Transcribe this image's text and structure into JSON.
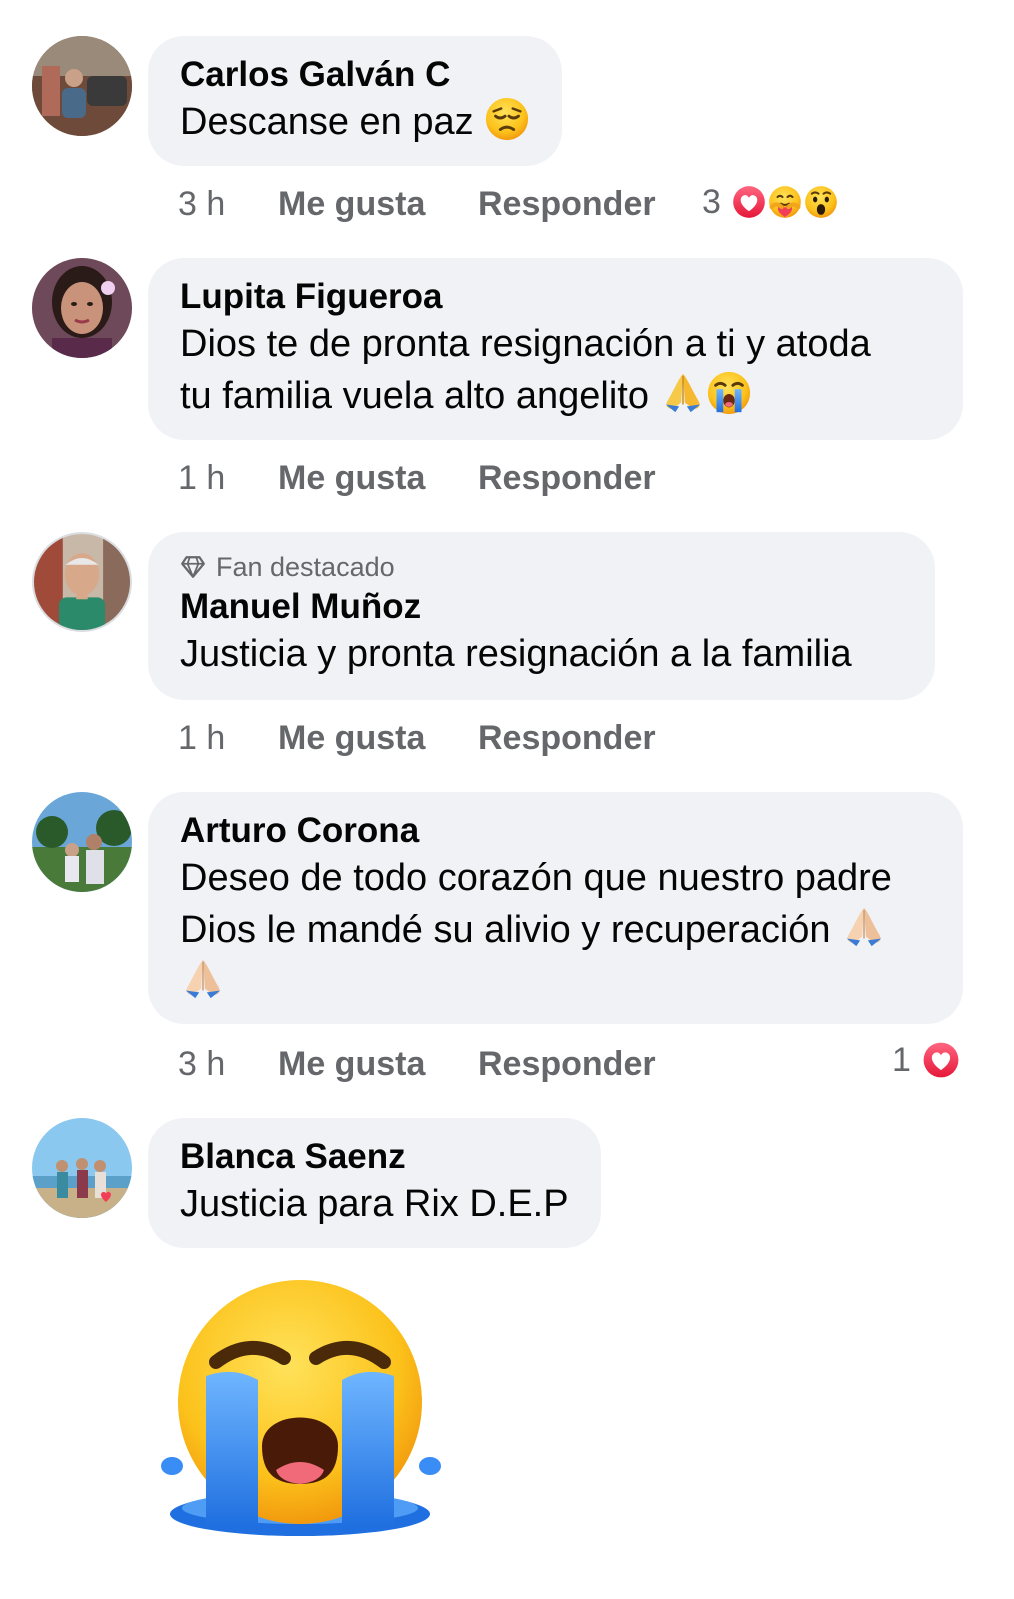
{
  "comments": [
    {
      "author": "Carlos Galván C",
      "text": "Descanse en paz",
      "emoji": [
        "pensive-face"
      ],
      "time": "3 h",
      "like_label": "Me gusta",
      "reply_label": "Responder",
      "reaction_count": "3",
      "reactions": [
        "love",
        "care",
        "wow"
      ]
    },
    {
      "author": "Lupita Figueroa",
      "text_line1": "Dios te de pronta resignación a ti y atoda",
      "text_line2": "tu familia vuela alto angelito",
      "emoji": [
        "folded-hands",
        "loudly-crying-face"
      ],
      "time": "1 h",
      "like_label": "Me gusta",
      "reply_label": "Responder"
    },
    {
      "badge": "Fan destacado",
      "author": "Manuel Muñoz",
      "text": "Justicia y pronta resignación a la familia",
      "time": "1 h",
      "like_label": "Me gusta",
      "reply_label": "Responder"
    },
    {
      "author": "Arturo Corona",
      "text_line1": "Deseo de todo corazón que nuestro padre",
      "text_line2": "Dios le mandé su alivio y recuperación",
      "emoji": [
        "folded-hands",
        "folded-hands"
      ],
      "time": "3 h",
      "like_label": "Me gusta",
      "reply_label": "Responder",
      "reaction_count": "1",
      "reactions": [
        "love"
      ]
    },
    {
      "author": "Blanca Saenz",
      "text": "Justicia para Rix D.E.P",
      "sticker": "loudly-crying-face-sticker"
    }
  ],
  "colors": {
    "bubble": "#f0f2f5",
    "meta_text": "#65676b",
    "text": "#050505",
    "love": "#f33e58",
    "emoji_yellow": "#fcc21b",
    "tears": "#3a8df5"
  }
}
